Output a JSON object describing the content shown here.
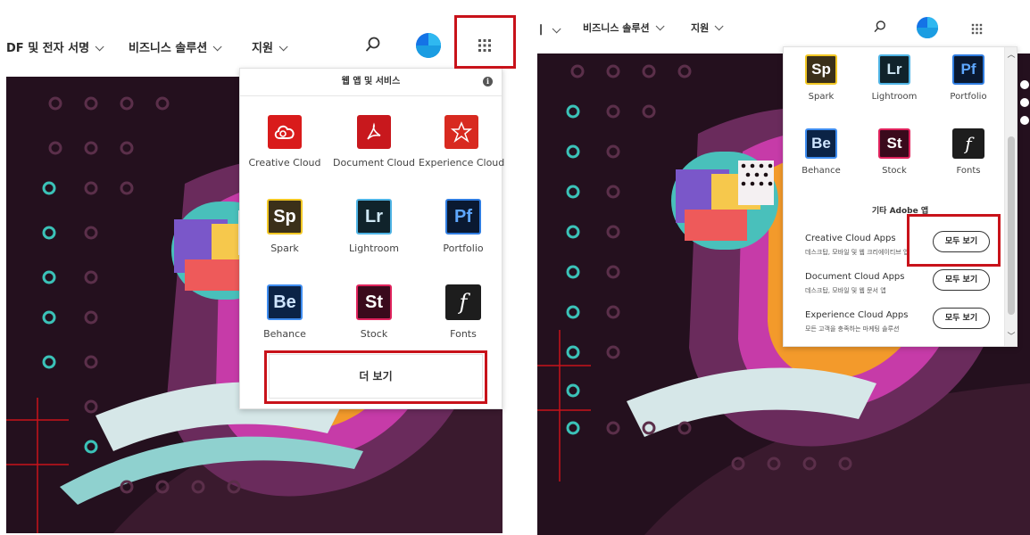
{
  "left": {
    "nav": {
      "item1": "DF 및 전자 서명",
      "item2": "비즈니스 솔루션",
      "item3": "지원"
    },
    "menu": {
      "header": "웹 앱 및 서비스",
      "apps": [
        {
          "label": "Creative Cloud",
          "icon": "creative-cloud-icon"
        },
        {
          "label": "Document Cloud",
          "icon": "document-cloud-icon"
        },
        {
          "label": "Experience Cloud",
          "icon": "experience-cloud-icon"
        },
        {
          "label": "Spark",
          "abbr": "Sp",
          "icon": "spark-icon"
        },
        {
          "label": "Lightroom",
          "abbr": "Lr",
          "icon": "lightroom-icon"
        },
        {
          "label": "Portfolio",
          "abbr": "Pf",
          "icon": "portfolio-icon"
        },
        {
          "label": "Behance",
          "abbr": "Be",
          "icon": "behance-icon"
        },
        {
          "label": "Stock",
          "abbr": "St",
          "icon": "stock-icon"
        },
        {
          "label": "Fonts",
          "abbr": "f",
          "icon": "fonts-icon"
        }
      ],
      "more_label": "더 보기"
    }
  },
  "right": {
    "nav": {
      "item1": "ㅣ",
      "item2": "비즈니스 솔루션",
      "item3": "지원"
    },
    "menu": {
      "apps": [
        {
          "label": "Spark",
          "abbr": "Sp"
        },
        {
          "label": "Lightroom",
          "abbr": "Lr"
        },
        {
          "label": "Portfolio",
          "abbr": "Pf"
        },
        {
          "label": "Behance",
          "abbr": "Be"
        },
        {
          "label": "Stock",
          "abbr": "St"
        },
        {
          "label": "Fonts",
          "abbr": "f"
        }
      ],
      "other_title": "기타 Adobe 앱",
      "other_apps": [
        {
          "name": "Creative Cloud Apps",
          "desc": "데스크탑, 모바일 및 웹 크리에이티브 앱",
          "button": "모두 보기"
        },
        {
          "name": "Document Cloud Apps",
          "desc": "데스크탑, 모바일 및 웹 문서 앱",
          "button": "모두 보기"
        },
        {
          "name": "Experience Cloud Apps",
          "desc": "모든 고객을 충족하는 마케팅 솔루션",
          "button": "모두 보기"
        }
      ]
    }
  },
  "colors": {
    "highlight": "#c8121a",
    "hero_background": "#24101e",
    "avatar": "#1473e6"
  }
}
